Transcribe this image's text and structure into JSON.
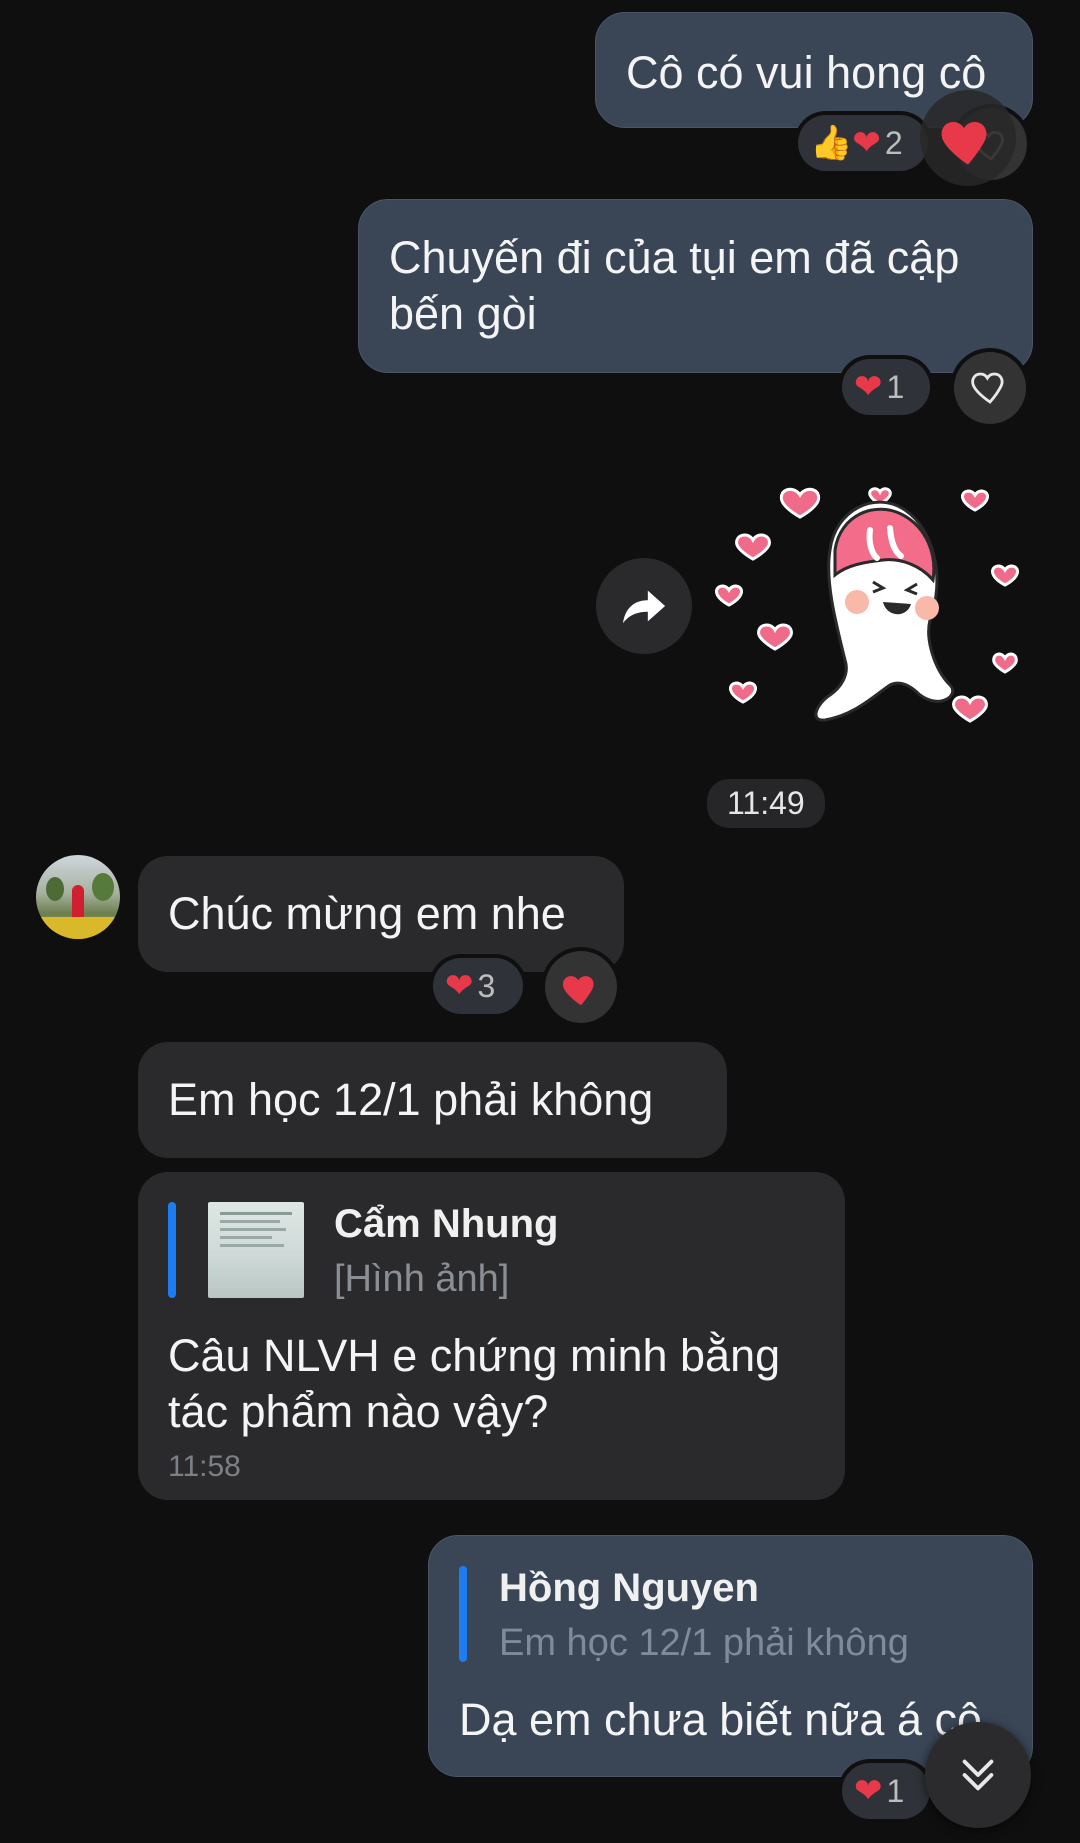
{
  "messages": {
    "m1": {
      "text": "Cô có vui hong cô",
      "reaction_count": "2"
    },
    "m2": {
      "text": "Chuyến đi của tụi em đã cập bến gòi",
      "reaction_count": "1"
    },
    "sticker": {
      "share_icon": "share-arrow-icon"
    },
    "time_1": "11:49",
    "m3": {
      "text": "Chúc mừng em nhe",
      "reaction_count": "3"
    },
    "m4": {
      "text": "Em học 12/1 phải không"
    },
    "m5": {
      "quote_name": "Cẩm Nhung",
      "quote_sub": "[Hình ảnh]",
      "text": "Câu NLVH e chứng minh bằng tác phẩm nào vậy?",
      "time": "11:58"
    },
    "m6": {
      "quote_name": "Hồng Nguyen",
      "quote_sub": "Em học 12/1 phải không",
      "text": "Dạ em chưa biết nữa á cô",
      "reaction_count": "1"
    }
  },
  "colors": {
    "outgoing_bubble": "#3a4656",
    "incoming_bubble": "#2a2a2c",
    "quote_bar": "#1e7cf2",
    "heart": "#e8394a"
  }
}
